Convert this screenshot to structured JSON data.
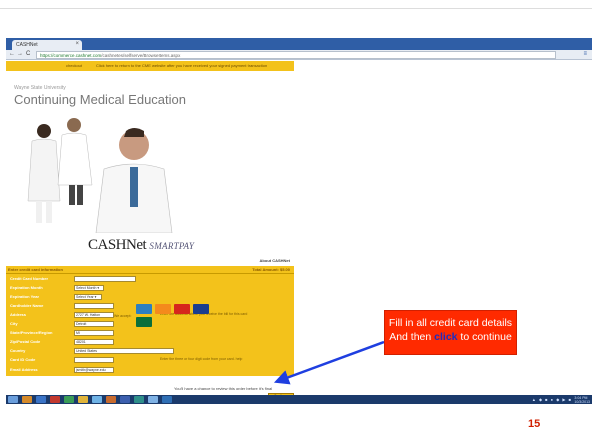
{
  "browser": {
    "tab_title": "CASHNet",
    "tab_close": "×",
    "back": "←",
    "forward": "→",
    "reload": "C",
    "url_secure": "https://commerce.cashnet.com",
    "url_rest": "/cashnetes/selfserve/BrowseItems.aspx",
    "menu_icon": "≡"
  },
  "page": {
    "notice_left": "checkout",
    "notice_right": "Click here to return to the CME website after you have received your signed payment transaction",
    "org_small": "Wayne State University",
    "org_big": "Continuing Medical Education",
    "brand_main": "CASHNet",
    "brand_sub": "SMARTPAY",
    "about": "About CASHNet",
    "form_title": "Enter credit card information",
    "total": "Total Amount: $5.00",
    "accepted_label": "We accept:",
    "fields": [
      {
        "label": "Credit Card Number",
        "value": "",
        "note": ""
      },
      {
        "label": "Expiration Month",
        "value": "Select Month ▾",
        "note": ""
      },
      {
        "label": "Expiration Year",
        "value": "Select Year ▾",
        "note": ""
      },
      {
        "label": "Cardholder Name",
        "value": "",
        "note": ""
      },
      {
        "label": "Address",
        "value": "2727 W. Hatton",
        "note": "Enter the address where you receive the bill for this card"
      },
      {
        "label": "City",
        "value": "Detroit",
        "note": ""
      },
      {
        "label": "State/Province/Region",
        "value": "MI",
        "note": ""
      },
      {
        "label": "Zip/Postal Code",
        "value": "48201",
        "note": ""
      },
      {
        "label": "Country",
        "value": "United States",
        "note": ""
      },
      {
        "label": "Card ID Code",
        "value": "",
        "note": "Enter the three or four digit code from your card. help"
      },
      {
        "label": "Email Address",
        "value": "jsmith@wayne.edu",
        "note": ""
      }
    ],
    "continue_msg": "You'll have a chance to review this order before it's final",
    "continue_btn": "Continue Checkout"
  },
  "callout": {
    "line1": "Fill in all credit card details",
    "line2_pre": "And then ",
    "line2_em": "click",
    "line2_post": " to continue"
  },
  "taskbar": {
    "tray": "▲ ◆ ■ ● ◆ ▶ ■",
    "clock_time": "3:04 PM",
    "clock_date": "10/3/2013"
  },
  "slide_number": "15",
  "colors": {
    "accent_yellow": "#f3c21b",
    "callout_red": "#ff2a00",
    "arrow_blue": "#1f3fe0",
    "page_number": "#d02000"
  }
}
